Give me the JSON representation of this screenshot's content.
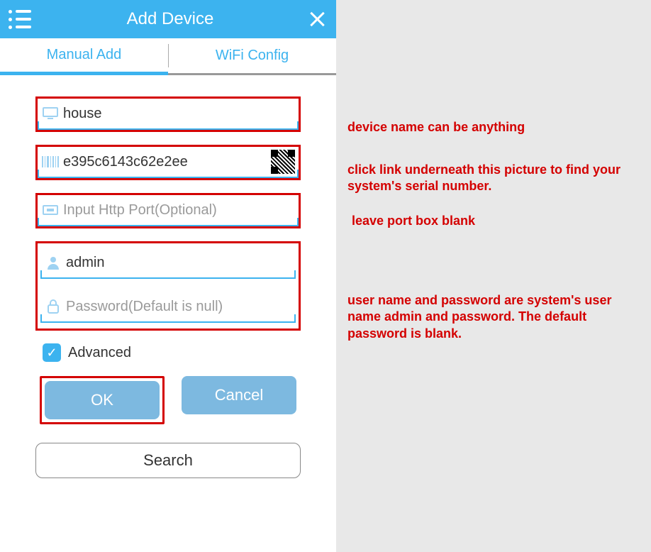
{
  "header": {
    "title": "Add Device"
  },
  "tabs": {
    "manual": "Manual Add",
    "wifi": "WiFi Config"
  },
  "fields": {
    "device_name": {
      "value": "house",
      "placeholder": ""
    },
    "serial": {
      "value": "e395c6143c62e2ee",
      "placeholder": ""
    },
    "port": {
      "value": "",
      "placeholder": "Input Http Port(Optional)"
    },
    "username": {
      "value": "admin",
      "placeholder": ""
    },
    "password": {
      "value": "",
      "placeholder": "Password(Default is null)"
    }
  },
  "advanced": {
    "label": "Advanced",
    "checked": true
  },
  "buttons": {
    "ok": "OK",
    "cancel": "Cancel",
    "search": "Search"
  },
  "annotations": {
    "device_name": "device name can be anything",
    "serial": "click link underneath this picture to find your system's serial number.",
    "port": "leave port box blank",
    "credentials": "user name and password are system's user name admin and password. The default password is blank."
  },
  "colors": {
    "primary": "#3cb3ef",
    "annotation": "#d40000",
    "button": "#7db9e0"
  }
}
